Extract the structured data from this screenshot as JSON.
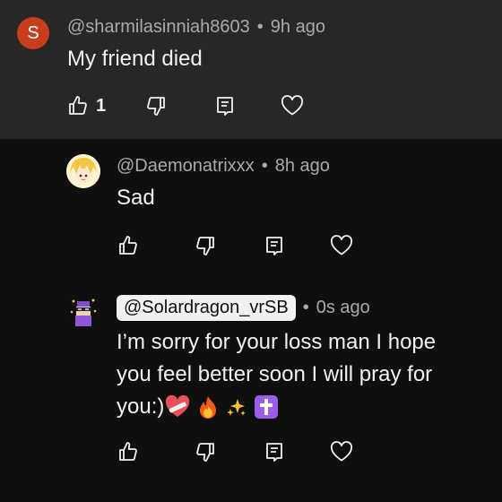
{
  "comments": [
    {
      "avatar_letter": "S",
      "author": "@sharmilasinniah8603",
      "time": "9h ago",
      "text": "My friend died",
      "likes": "1"
    },
    {
      "author": "@Daemonatrixxx",
      "time": "8h ago",
      "text": "Sad"
    },
    {
      "author": "@Solardragon_vrSB",
      "time": "0s ago",
      "text_line1": "I’m sorry for your loss man I hope",
      "text_line2": "you feel better soon I will pray for",
      "text_line3": "you:)"
    }
  ],
  "meta_separator": "•",
  "emojis": [
    "heart-with-bandage",
    "fire",
    "sparkles",
    "latin-cross"
  ]
}
